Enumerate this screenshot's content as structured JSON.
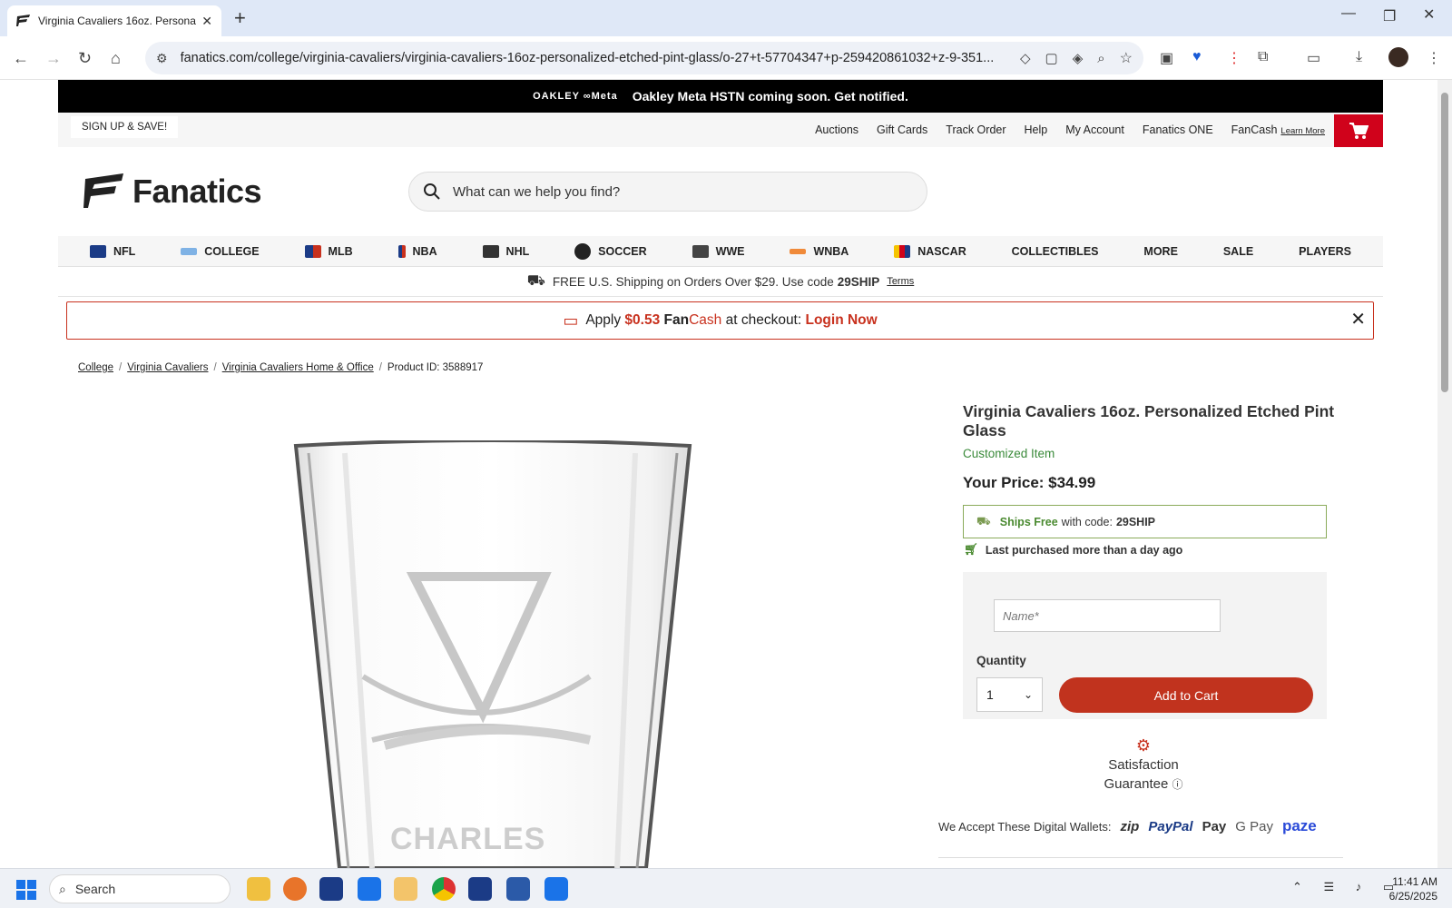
{
  "browser": {
    "tab_title": "Virginia Cavaliers 16oz. Personaliz",
    "url": "fanatics.com/college/virginia-cavaliers/virginia-cavaliers-16oz-personalized-etched-pint-glass/o-27+t-57704347+p-259420861032+z-9-351..."
  },
  "promo": {
    "brand_text": "OAKLEY  ∞Meta",
    "text": "Oakley Meta HSTN coming soon. Get notified."
  },
  "util": {
    "signup": "SIGN UP & SAVE!",
    "links": [
      "Auctions",
      "Gift Cards",
      "Track Order",
      "Help",
      "My Account",
      "Fanatics ONE",
      "FanCash"
    ],
    "learn_more": "Learn More"
  },
  "logo": {
    "text": "Fanatics"
  },
  "search": {
    "placeholder": "What can we help you find?"
  },
  "categories": [
    "NFL",
    "COLLEGE",
    "MLB",
    "NBA",
    "NHL",
    "SOCCER",
    "WWE",
    "WNBA",
    "NASCAR",
    "COLLECTIBLES",
    "MORE",
    "SALE",
    "PLAYERS"
  ],
  "shipping": {
    "text": "FREE U.S. Shipping on Orders Over $29. Use code",
    "code": "29SHIP",
    "terms": "Terms"
  },
  "fancash": {
    "pre": "Apply",
    "amount": "$0.53",
    "fan": "Fan",
    "cash": "Cash",
    "mid": "at checkout:",
    "login": "Login Now"
  },
  "breadcrumb": {
    "items": [
      "College",
      "Virginia Cavaliers",
      "Virginia Cavaliers Home & Office"
    ],
    "product_id": "Product ID: 3588917"
  },
  "product": {
    "title": "Virginia Cavaliers 16oz. Personalized Etched Pint Glass",
    "custom": "Customized Item",
    "price": "Your Price: $34.99",
    "ship_free": "Ships Free",
    "ship_with": "with code:",
    "ship_code": "29SHIP",
    "last_purchased": "Last purchased more than a day ago",
    "name_placeholder": "Name*",
    "quantity_label": "Quantity",
    "quantity": "1",
    "add_to_cart": "Add to Cart",
    "satisfaction_1": "Satisfaction",
    "satisfaction_2": "Guarantee",
    "wallets_label": "We Accept These Digital Wallets:",
    "wallets": [
      "zip",
      "PayPal",
      " Pay",
      "G Pay",
      "paze"
    ],
    "glass_text": "CHARLES"
  },
  "taskbar": {
    "search": "Search",
    "time": "11:41 AM",
    "date": "6/25/2025"
  },
  "colors": {
    "brand_red": "#c8311e",
    "green": "#3a8a3a"
  }
}
